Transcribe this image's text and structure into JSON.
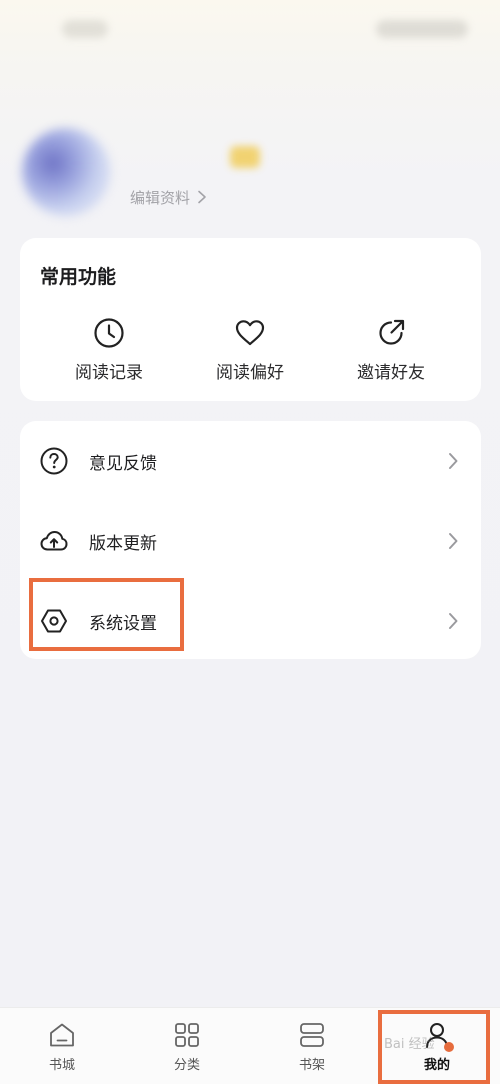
{
  "profile": {
    "username": "",
    "edit_label": "编辑资料"
  },
  "common": {
    "title": "常用功能",
    "items": [
      {
        "label": "阅读记录",
        "icon": "clock-icon"
      },
      {
        "label": "阅读偏好",
        "icon": "heart-icon"
      },
      {
        "label": "邀请好友",
        "icon": "share-arrow-icon"
      }
    ]
  },
  "menu": {
    "items": [
      {
        "label": "意见反馈",
        "icon": "question-circle-icon"
      },
      {
        "label": "版本更新",
        "icon": "cloud-upload-icon"
      },
      {
        "label": "系统设置",
        "icon": "hexagon-settings-icon"
      }
    ]
  },
  "bottom_nav": {
    "items": [
      {
        "label": "书城",
        "icon": "home-icon"
      },
      {
        "label": "分类",
        "icon": "grid-icon"
      },
      {
        "label": "书架",
        "icon": "bookshelf-icon"
      },
      {
        "label": "我的",
        "icon": "profile-icon",
        "active": true
      }
    ]
  },
  "watermark": "Bai 经验",
  "colors": {
    "highlight": "#e96d3f",
    "badge": "#f1cf63",
    "background": "#f2f2f6"
  }
}
